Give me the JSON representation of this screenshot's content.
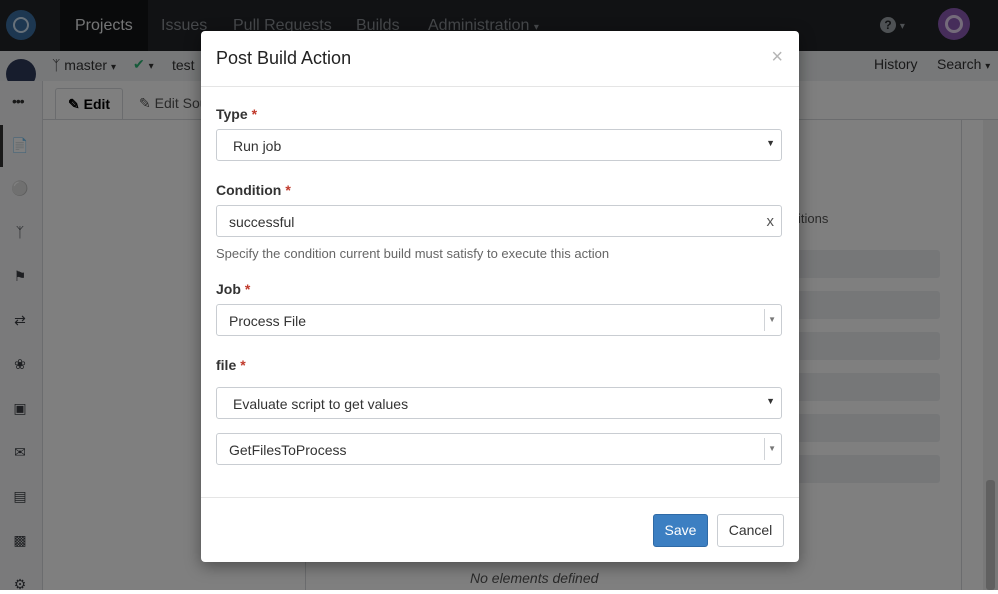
{
  "topnav": {
    "items": [
      "Projects",
      "Issues",
      "Pull Requests",
      "Builds",
      "Administration"
    ],
    "help_glyph": "?"
  },
  "subbar": {
    "branch_label": "master",
    "test_label": "test",
    "history_label": "History",
    "search_label": "Search"
  },
  "tabs": {
    "edit_label": "Edit",
    "edit_source_label": "Edit Sou"
  },
  "background": {
    "conditions_fragment": "itions",
    "no_elements": "No elements defined"
  },
  "modal": {
    "title": "Post Build Action",
    "close_glyph": "×",
    "type": {
      "label": "Type",
      "value": "Run job"
    },
    "condition": {
      "label": "Condition",
      "value": "successful",
      "clear_glyph": "x",
      "help": "Specify the condition current build must satisfy to execute this action"
    },
    "job": {
      "label": "Job",
      "value": "Process File"
    },
    "file": {
      "label": "file",
      "mode_value": "Evaluate script to get values",
      "script_value": "GetFilesToProcess"
    },
    "required_marker": "*",
    "save_label": "Save",
    "cancel_label": "Cancel"
  }
}
